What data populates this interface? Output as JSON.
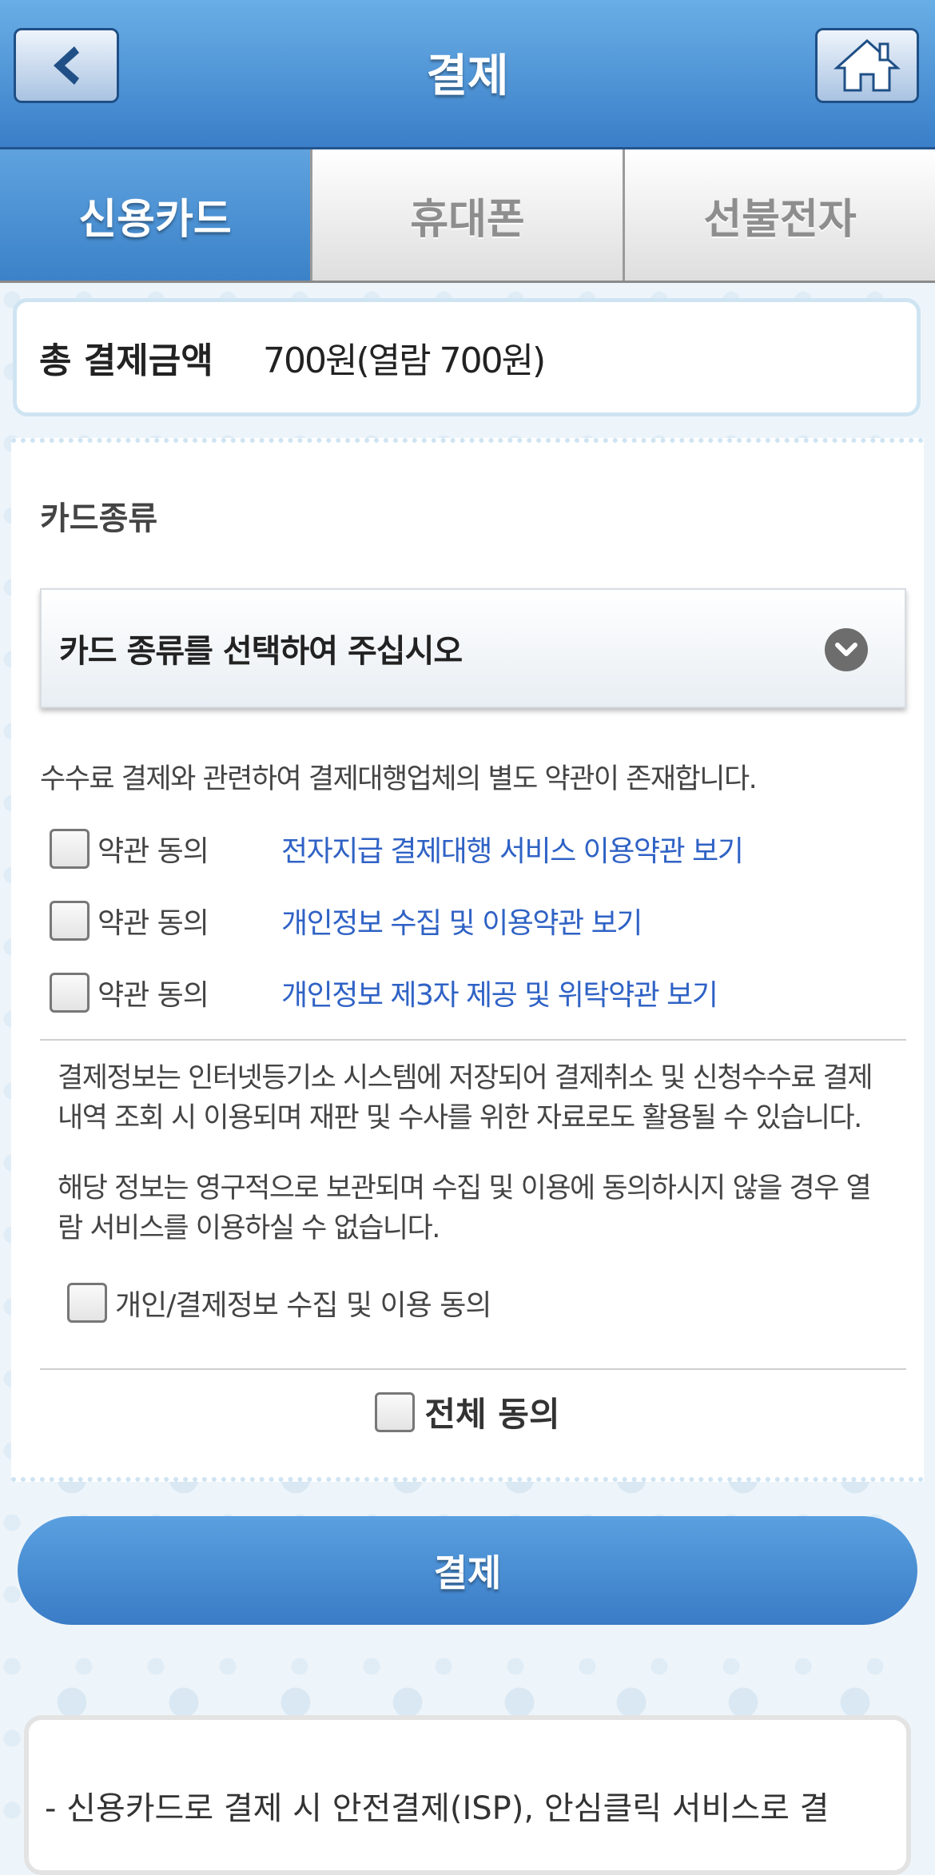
{
  "header": {
    "title": "결제"
  },
  "tabs": [
    {
      "label": "신용카드",
      "active": true
    },
    {
      "label": "휴대폰",
      "active": false
    },
    {
      "label": "선불전자",
      "active": false
    }
  ],
  "amount": {
    "label": "총 결제금액",
    "value": "700원(열람 700원)"
  },
  "card_section": {
    "title": "카드종류",
    "select_placeholder": "카드 종류를 선택하여 주십시오"
  },
  "terms": {
    "notice": "수수료 결제와 관련하여 결제대행업체의 별도 약관이 존재합니다.",
    "items": [
      {
        "label": "약관 동의",
        "link": "전자지급 결제대행 서비스 이용약관 보기"
      },
      {
        "label": "약관 동의",
        "link": "개인정보 수집 및 이용약관 보기"
      },
      {
        "label": "약관 동의",
        "link": "개인정보 제3자 제공 및 위탁약관 보기"
      }
    ]
  },
  "info_text": {
    "para1_line1": "결제정보는 인터넷등기소 시스템에 저장되어 결제취소 및 신청수수료 결제",
    "para1_line2": "내역 조회 시 이용되며 재판 및 수사를 위한 자료로도 활용될 수 있습니다.",
    "para2_line1": "해당 정보는 영구적으로 보관되며 수집 및 이용에 동의하시지 않을 경우 열",
    "para2_line2": "람 서비스를 이용하실 수 없습니다.",
    "personal_agree": "개인/결제정보 수집 및 이용 동의"
  },
  "all_agree": "전체 동의",
  "pay_button": "결제",
  "bottom_info": "- 신용카드로 결제 시 안전결제(ISP), 안심클릭 서비스로 결",
  "colors": {
    "header_blue": "#3a7fc8",
    "link_blue": "#2f62c5",
    "tab_active": "#4a8fd4"
  }
}
